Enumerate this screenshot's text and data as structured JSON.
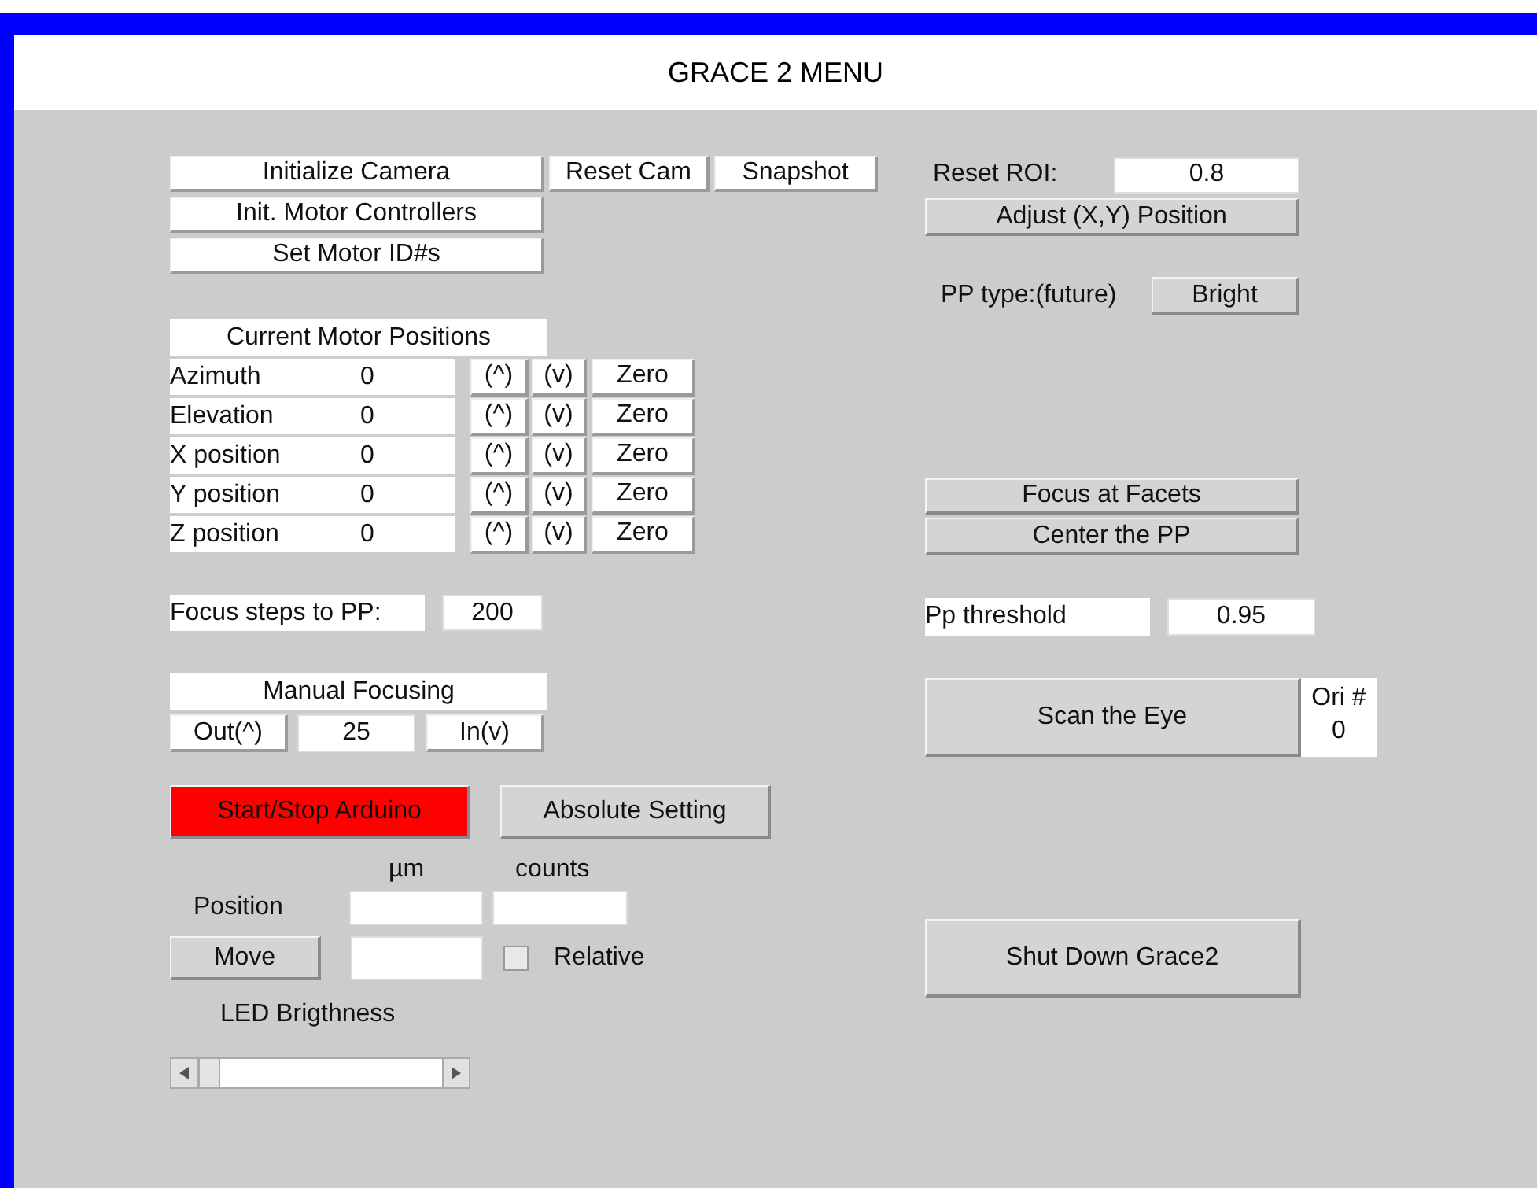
{
  "window": {
    "title": "GRACE 2 MENU"
  },
  "camera_buttons": [
    "Initialize Camera",
    "Reset Cam",
    "Snapshot"
  ],
  "motor_buttons": [
    "Init. Motor Controllers",
    "Set Motor ID#s"
  ],
  "motor_positions": {
    "title": "Current Motor Positions",
    "rows": [
      {
        "name": "Azimuth",
        "value": "0",
        "up_label": "(^)",
        "down_label": "(v)",
        "zero_label": "Zero"
      },
      {
        "name": "Elevation",
        "value": "0",
        "up_label": "(^)",
        "down_label": "(v)",
        "zero_label": "Zero"
      },
      {
        "name": "X position",
        "value": "0",
        "up_label": "(^)",
        "down_label": "(v)",
        "zero_label": "Zero"
      },
      {
        "name": "Y position",
        "value": "0",
        "up_label": "(^)",
        "down_label": "(v)",
        "zero_label": "Zero"
      },
      {
        "name": "Z position",
        "value": "0",
        "up_label": "(^)",
        "down_label": "(v)",
        "zero_label": "Zero"
      }
    ]
  },
  "focus_steps": {
    "label": "Focus steps to PP:",
    "value": "200"
  },
  "manual_focusing": {
    "title": "Manual Focusing",
    "out_button": "Out(^)",
    "value": "25",
    "in_button": "In(v)"
  },
  "arduino_button": {
    "label": "Start/Stop Arduino",
    "on": true
  },
  "absolute_setting_button": "Absolute Setting",
  "position": {
    "unit_um": "µm",
    "unit_counts": "counts",
    "label": "Position",
    "move_button": "Move",
    "relative": {
      "label": "Relative",
      "checked": false
    }
  },
  "led": {
    "label": "LED Brigthness",
    "level": 0.0
  },
  "roi": {
    "label": "Reset ROI:",
    "value": "0.8",
    "adjust_button": "Adjust (X,Y) Position"
  },
  "pp_type": {
    "label": "PP type:(future)",
    "button": "Bright"
  },
  "focus_buttons": [
    "Focus at Facets",
    "Center the PP"
  ],
  "pp_threshold": {
    "label": "Pp threshold",
    "value": "0.95"
  },
  "scan": {
    "button": "Scan the Eye",
    "ori_label": "Ori #",
    "ori_value": "0"
  },
  "shutdown_button": "Shut Down Grace2"
}
